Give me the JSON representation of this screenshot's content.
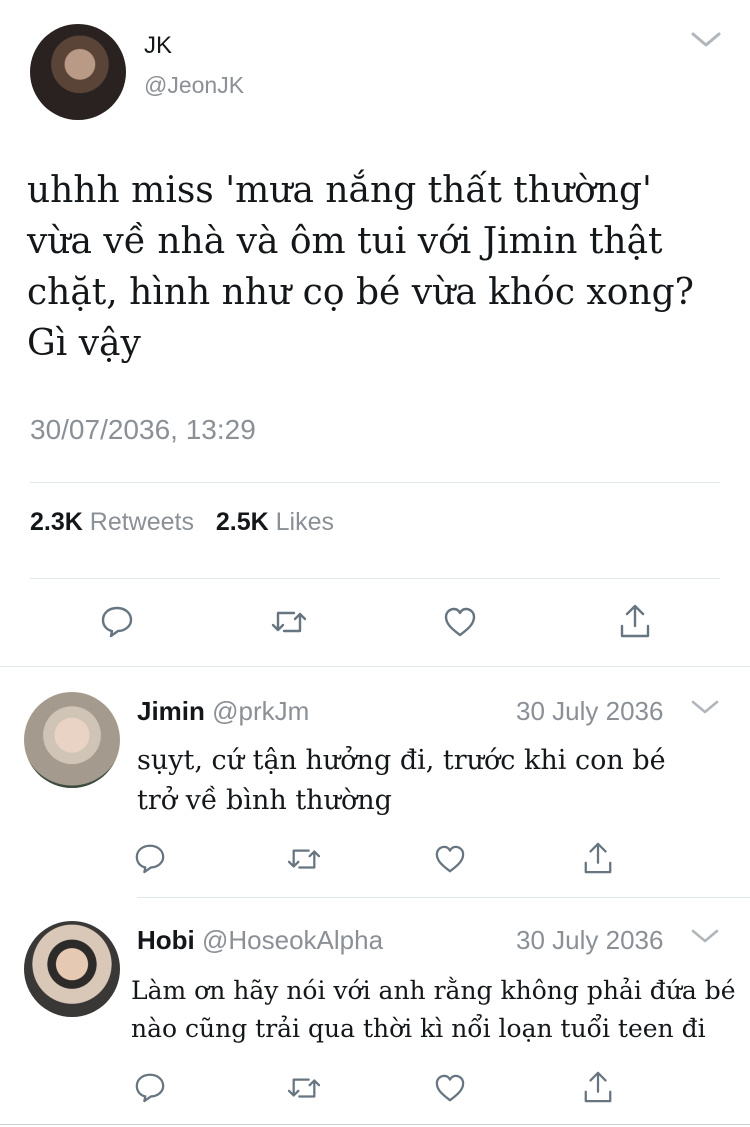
{
  "main_tweet": {
    "author_name": "JK",
    "author_handle": "@JeonJK",
    "text_lines": [
      "uhhh miss 'mưa nắng thất thường'",
      "vừa về nhà và ôm tui với Jimin thật",
      "chặt, hình như cọ bé vừa khóc xong?",
      "Gì vậy"
    ],
    "timestamp": "30/07/2036, 13:29",
    "retweets_count": "2.3K",
    "retweets_label": "Retweets",
    "likes_count": "2.5K",
    "likes_label": "Likes"
  },
  "replies": [
    {
      "name": "Jimin",
      "handle": "@prkJm",
      "date": "30 July 2036",
      "text_lines": [
        "sụyt, cứ tận hưởng đi, trước khi con bé",
        "trở về bình thường"
      ]
    },
    {
      "name": "Hobi",
      "handle": "@HoseokAlpha",
      "date": "30 July 2036",
      "text_lines": [
        "Làm ơn hãy nói với anh rằng không phải đứa bé",
        "nào cũng trải qua thời kì nổi loạn tuổi teen đi"
      ]
    }
  ],
  "icons": {
    "reply": "reply-icon",
    "retweet": "retweet-icon",
    "like": "heart-icon",
    "share": "share-icon",
    "more": "chevron-down-icon"
  },
  "colors": {
    "text": "#14171a",
    "muted": "#8a9096",
    "divider": "#e1e6ea"
  }
}
